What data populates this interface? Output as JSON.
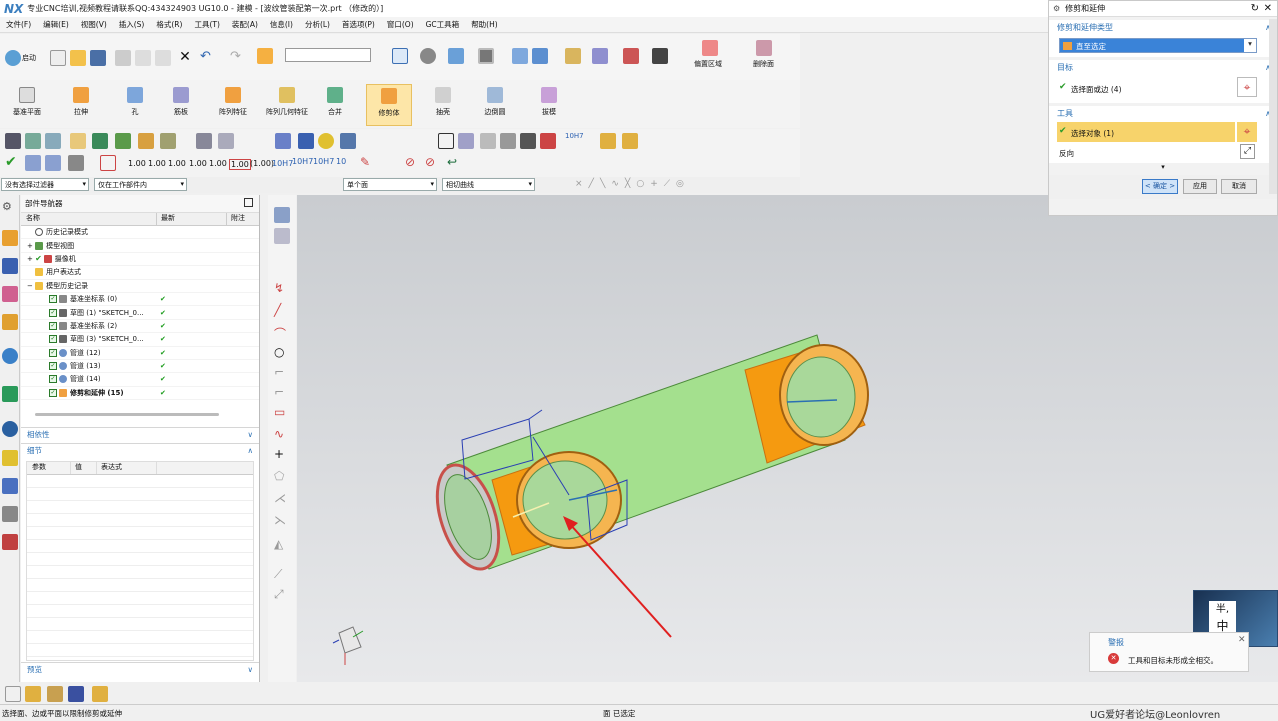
{
  "app": {
    "logo": "NX",
    "title": "专业CNC培训,视频教程请联系QQ:434324903 UG10.0 - 建模 - [波纹管装配第一次.prt （修改的）]"
  },
  "menu": [
    "文件(F)",
    "编辑(E)",
    "视图(V)",
    "插入(S)",
    "格式(R)",
    "工具(T)",
    "装配(A)",
    "信息(I)",
    "分析(L)",
    "首选项(P)",
    "窗口(O)",
    "GC工具箱",
    "帮助(H)"
  ],
  "toolbar": {
    "start_label": "启动",
    "offset_region": "偏置区域",
    "delete_face": "删除面"
  },
  "ribbon": [
    "基准平面",
    "拉伸",
    "孔",
    "筋板",
    "阵列特征",
    "阵列几何特征",
    "合并",
    "修剪体",
    "抽壳",
    "边倒圆",
    "拔模"
  ],
  "dims": [
    "1.00",
    "1.00",
    "1.00",
    "1.00",
    "1.00",
    "1.00",
    "(1.00)",
    "10H7",
    "10H7",
    "10H7",
    "10",
    "10H7"
  ],
  "filter": {
    "type": "没有选择过滤器",
    "scope": "仅在工作部件内",
    "face_rule": "单个面",
    "curve_rule": "相切曲线"
  },
  "navigator": {
    "title": "部件导航器",
    "cols": [
      "名称",
      "最新",
      "附注"
    ],
    "rows": [
      {
        "name": "历史记录模式",
        "latest": ""
      },
      {
        "name": "模型视图",
        "latest": ""
      },
      {
        "name": "摄像机",
        "latest": ""
      },
      {
        "name": "用户表达式",
        "latest": ""
      },
      {
        "name": "模型历史记录",
        "latest": ""
      },
      {
        "name": "基准坐标系 (0)",
        "latest": "✔"
      },
      {
        "name": "草图 (1) \"SKETCH_0...",
        "latest": "✔"
      },
      {
        "name": "基准坐标系 (2)",
        "latest": "✔"
      },
      {
        "name": "草图 (3) \"SKETCH_0...",
        "latest": "✔"
      },
      {
        "name": "管道 (12)",
        "latest": "✔"
      },
      {
        "name": "管道 (13)",
        "latest": "✔"
      },
      {
        "name": "管道 (14)",
        "latest": "✔"
      },
      {
        "name": "修剪和延伸 (15)",
        "latest": "✔"
      }
    ],
    "dependency": "相依性",
    "details": "细节",
    "detail_cols": [
      "参数",
      "值",
      "表达式"
    ],
    "preview": "预览"
  },
  "dialog": {
    "title": "修剪和延伸",
    "type_section": "修剪和延伸类型",
    "type_value": "直至选定",
    "target_section": "目标",
    "target_select": "选择面或边 (4)",
    "tool_section": "工具",
    "tool_select": "选择对象 (1)",
    "reverse": "反向",
    "ok": "< 确定 >",
    "apply": "应用",
    "cancel": "取消"
  },
  "alert": {
    "title": "警报",
    "message": "工具和目标未形成全相交。"
  },
  "ime": {
    "line1": "半,",
    "line2": "中"
  },
  "status": {
    "left": "选择面、边或平面以限制修剪或延伸",
    "mid": "面 已选定",
    "watermark": "UG爱好者论坛@Leonlovren"
  },
  "colors": {
    "pipe_green": "#a4e08e",
    "pipe_orange": "#f59a10",
    "accent": "#2a6fb3",
    "selected_bg": "#f7d36b"
  }
}
